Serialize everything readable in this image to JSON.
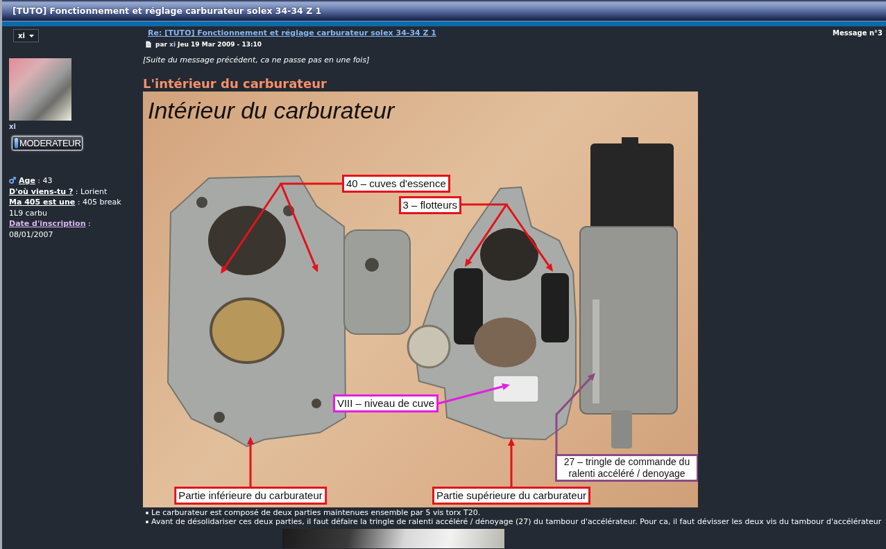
{
  "page_title": "[TUTO] Fonctionnement et réglage carburateur solex 34-34 Z 1",
  "sidebar": {
    "user_menu": "xi",
    "username": "xi",
    "rank": "MODERATEUR",
    "field_separator": ":",
    "fields": [
      {
        "label": "Age",
        "value": "43",
        "color": "#ffffff"
      },
      {
        "label": "D'où viens-tu ?",
        "value": "Lorient",
        "color": "#ffffff"
      },
      {
        "label": "Ma 405 est une",
        "value": "405 break 1L9 carbu",
        "color": "#ffffff"
      },
      {
        "label": "Date d'inscription",
        "value": "08/01/2007",
        "color": "#d9b6f2"
      }
    ]
  },
  "post": {
    "title": "Re: [TUTO] Fonctionnement et réglage carburateur solex 34-34 Z 1",
    "number": "Message n°3",
    "byline": {
      "prefix": "par",
      "author": "xi",
      "date": "Jeu 19 Mar 2009 - 13:10"
    },
    "intro": "[Suite du message précédent, ca ne passe pas en une fois]",
    "heading": "L'intérieur du carburateur",
    "figure": {
      "title": "Intérieur du carburateur",
      "callouts": [
        {
          "text": "40 – cuves d'essence",
          "color": "#e3121b"
        },
        {
          "text": "3 – flotteurs",
          "color": "#e3121b"
        },
        {
          "text": "VIII – niveau de cuve",
          "color": "#e020e0"
        },
        {
          "text": "27 – tringle de commande du ralenti accéléré / denoyage",
          "color": "#8c4a82"
        },
        {
          "text": "Partie inférieure du carburateur",
          "color": "#e3121b"
        },
        {
          "text": "Partie supérieure du carburateur",
          "color": "#e3121b"
        }
      ]
    },
    "bullets": [
      "Le carburateur est composé de deux parties maintenues ensemble par 5 vis torx T20.",
      "Avant de désolidariser ces deux parties, il faut défaire la tringle de ralenti accéléré / dénoyage (27) du tambour d'accélérateur. Pour ca, il faut dévisser les deux vis du tambour d'accélérateur"
    ]
  }
}
